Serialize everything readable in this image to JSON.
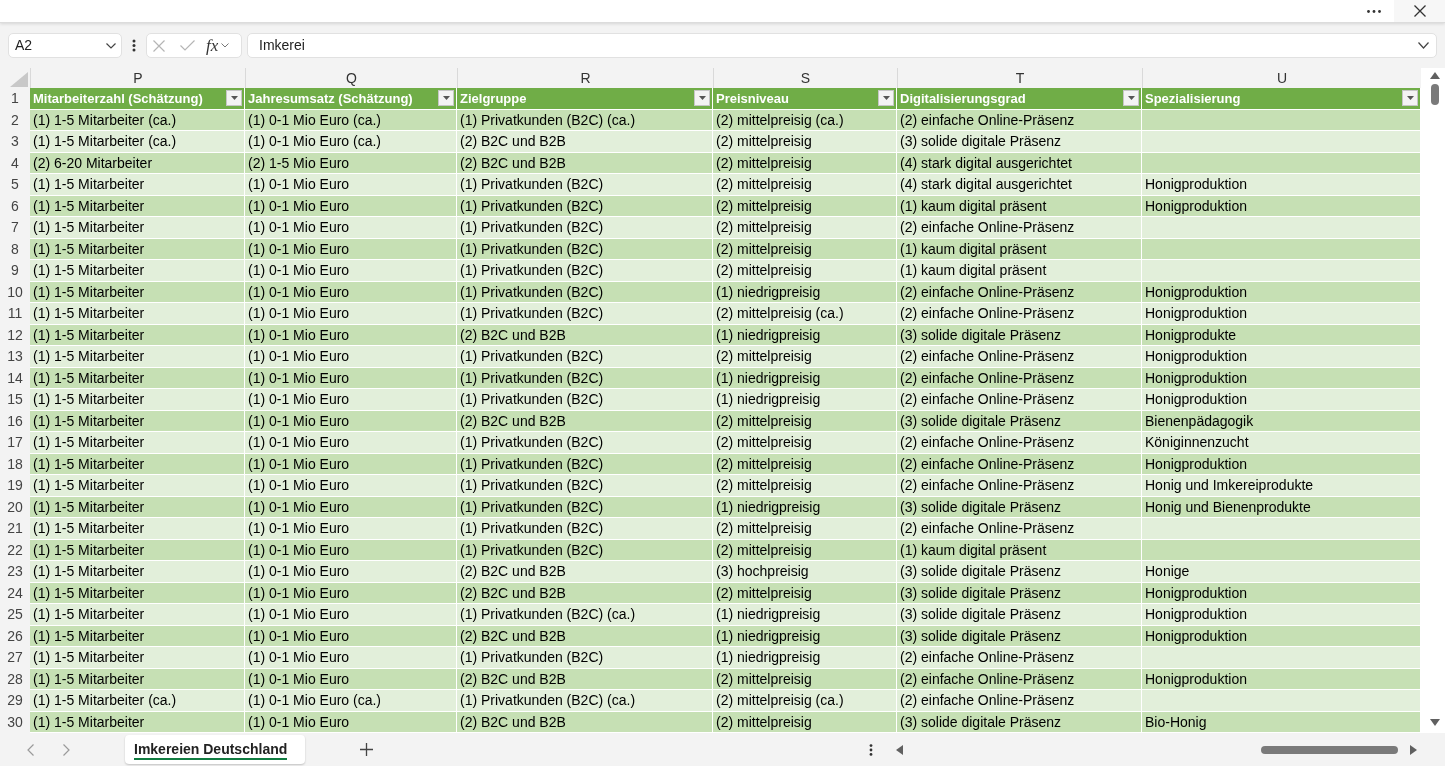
{
  "formula_bar": {
    "name_box": "A2",
    "function_label": "fx",
    "formula": "Imkerei"
  },
  "sheet": {
    "header_row_number": "1",
    "columns": [
      {
        "letter": "P",
        "header": "Mitarbeiterzahl (Schätzung)"
      },
      {
        "letter": "Q",
        "header": "Jahresumsatz (Schätzung)"
      },
      {
        "letter": "R",
        "header": "Zielgruppe"
      },
      {
        "letter": "S",
        "header": "Preisniveau"
      },
      {
        "letter": "T",
        "header": "Digitalisierungsgrad"
      },
      {
        "letter": "U",
        "header": "Spezialisierung"
      }
    ],
    "rows": [
      {
        "number": "2",
        "cells": [
          "(1) 1-5 Mitarbeiter (ca.)",
          "(1) 0-1 Mio Euro (ca.)",
          "(1) Privatkunden (B2C) (ca.)",
          "(2) mittelpreisig (ca.)",
          "(2) einfache Online-Präsenz"
        ]
      },
      {
        "number": "3",
        "cells": [
          "(1) 1-5 Mitarbeiter (ca.)",
          "(1) 0-1 Mio Euro (ca.)",
          "(2) B2C und B2B",
          "(2) mittelpreisig",
          "(3) solide digitale Präsenz"
        ]
      },
      {
        "number": "4",
        "cells": [
          "(2) 6-20 Mitarbeiter",
          "(2) 1-5 Mio Euro",
          "(2) B2C und B2B",
          "(2) mittelpreisig",
          "(4) stark digital ausgerichtet"
        ]
      },
      {
        "number": "5",
        "cells": [
          "(1) 1-5 Mitarbeiter",
          "(1) 0-1 Mio Euro",
          "(1) Privatkunden (B2C)",
          "(2) mittelpreisig",
          "(4) stark digital ausgerichtet",
          "Honigproduktion"
        ]
      },
      {
        "number": "6",
        "cells": [
          "(1) 1-5 Mitarbeiter",
          "(1) 0-1 Mio Euro",
          "(1) Privatkunden (B2C)",
          "(2) mittelpreisig",
          "(1) kaum digital präsent",
          "Honigproduktion"
        ]
      },
      {
        "number": "7",
        "cells": [
          "(1) 1-5 Mitarbeiter",
          "(1) 0-1 Mio Euro",
          "(1) Privatkunden (B2C)",
          "(2) mittelpreisig",
          "(2) einfache Online-Präsenz"
        ]
      },
      {
        "number": "8",
        "cells": [
          "(1) 1-5 Mitarbeiter",
          "(1) 0-1 Mio Euro",
          "(1) Privatkunden (B2C)",
          "(2) mittelpreisig",
          "(1) kaum digital präsent"
        ]
      },
      {
        "number": "9",
        "cells": [
          "(1) 1-5 Mitarbeiter",
          "(1) 0-1 Mio Euro",
          "(1) Privatkunden (B2C)",
          "(2) mittelpreisig",
          "(1) kaum digital präsent"
        ]
      },
      {
        "number": "10",
        "cells": [
          "(1) 1-5 Mitarbeiter",
          "(1) 0-1 Mio Euro",
          "(1) Privatkunden (B2C)",
          "(1) niedrigpreisig",
          "(2) einfache Online-Präsenz",
          "Honigproduktion"
        ]
      },
      {
        "number": "11",
        "cells": [
          "(1) 1-5 Mitarbeiter",
          "(1) 0-1 Mio Euro",
          "(1) Privatkunden (B2C)",
          "(2) mittelpreisig (ca.)",
          "(2) einfache Online-Präsenz",
          "Honigproduktion"
        ]
      },
      {
        "number": "12",
        "cells": [
          "(1) 1-5 Mitarbeiter",
          "(1) 0-1 Mio Euro",
          "(2) B2C und B2B",
          "(1) niedrigpreisig",
          "(3) solide digitale Präsenz",
          "Honigprodukte"
        ]
      },
      {
        "number": "13",
        "cells": [
          "(1) 1-5 Mitarbeiter",
          "(1) 0-1 Mio Euro",
          "(1) Privatkunden (B2C)",
          "(2) mittelpreisig",
          "(2) einfache Online-Präsenz",
          "Honigproduktion"
        ]
      },
      {
        "number": "14",
        "cells": [
          "(1) 1-5 Mitarbeiter",
          "(1) 0-1 Mio Euro",
          "(1) Privatkunden (B2C)",
          "(1) niedrigpreisig",
          "(2) einfache Online-Präsenz",
          "Honigproduktion"
        ]
      },
      {
        "number": "15",
        "cells": [
          "(1) 1-5 Mitarbeiter",
          "(1) 0-1 Mio Euro",
          "(1) Privatkunden (B2C)",
          "(1) niedrigpreisig",
          "(2) einfache Online-Präsenz",
          "Honigproduktion"
        ]
      },
      {
        "number": "16",
        "cells": [
          "(1) 1-5 Mitarbeiter",
          "(1) 0-1 Mio Euro",
          "(2) B2C und B2B",
          "(2) mittelpreisig",
          "(3) solide digitale Präsenz",
          "Bienenpädagogik"
        ]
      },
      {
        "number": "17",
        "cells": [
          "(1) 1-5 Mitarbeiter",
          "(1) 0-1 Mio Euro",
          "(1) Privatkunden (B2C)",
          "(2) mittelpreisig",
          "(2) einfache Online-Präsenz",
          "Königinnenzucht"
        ]
      },
      {
        "number": "18",
        "cells": [
          "(1) 1-5 Mitarbeiter",
          "(1) 0-1 Mio Euro",
          "(1) Privatkunden (B2C)",
          "(2) mittelpreisig",
          "(2) einfache Online-Präsenz",
          "Honigproduktion"
        ]
      },
      {
        "number": "19",
        "cells": [
          "(1) 1-5 Mitarbeiter",
          "(1) 0-1 Mio Euro",
          "(1) Privatkunden (B2C)",
          "(2) mittelpreisig",
          "(2) einfache Online-Präsenz",
          "Honig und Imkereiprodukte"
        ]
      },
      {
        "number": "20",
        "cells": [
          "(1) 1-5 Mitarbeiter",
          "(1) 0-1 Mio Euro",
          "(1) Privatkunden (B2C)",
          "(1) niedrigpreisig",
          "(3) solide digitale Präsenz",
          "Honig und Bienenprodukte"
        ]
      },
      {
        "number": "21",
        "cells": [
          "(1) 1-5 Mitarbeiter",
          "(1) 0-1 Mio Euro",
          "(1) Privatkunden (B2C)",
          "(2) mittelpreisig",
          "(2) einfache Online-Präsenz"
        ]
      },
      {
        "number": "22",
        "cells": [
          "(1) 1-5 Mitarbeiter",
          "(1) 0-1 Mio Euro",
          "(1) Privatkunden (B2C)",
          "(2) mittelpreisig",
          "(1) kaum digital präsent"
        ]
      },
      {
        "number": "23",
        "cells": [
          "(1) 1-5 Mitarbeiter",
          "(1) 0-1 Mio Euro",
          "(2) B2C und B2B",
          "(3) hochpreisig",
          "(3) solide digitale Präsenz",
          "Honige"
        ]
      },
      {
        "number": "24",
        "cells": [
          "(1) 1-5 Mitarbeiter",
          "(1) 0-1 Mio Euro",
          "(2) B2C und B2B",
          "(2) mittelpreisig",
          "(3) solide digitale Präsenz",
          "Honigproduktion"
        ]
      },
      {
        "number": "25",
        "cells": [
          "(1) 1-5 Mitarbeiter",
          "(1) 0-1 Mio Euro",
          "(1) Privatkunden (B2C) (ca.)",
          "(1) niedrigpreisig",
          "(3) solide digitale Präsenz",
          "Honigproduktion"
        ]
      },
      {
        "number": "26",
        "cells": [
          "(1) 1-5 Mitarbeiter",
          "(1) 0-1 Mio Euro",
          "(2) B2C und B2B",
          "(1) niedrigpreisig",
          "(3) solide digitale Präsenz",
          "Honigproduktion"
        ]
      },
      {
        "number": "27",
        "cells": [
          "(1) 1-5 Mitarbeiter",
          "(1) 0-1 Mio Euro",
          "(1) Privatkunden (B2C)",
          "(1) niedrigpreisig",
          "(2) einfache Online-Präsenz"
        ]
      },
      {
        "number": "28",
        "cells": [
          "(1) 1-5 Mitarbeiter",
          "(1) 0-1 Mio Euro",
          "(2) B2C und B2B",
          "(2) mittelpreisig",
          "(2) einfache Online-Präsenz",
          "Honigproduktion"
        ]
      },
      {
        "number": "29",
        "cells": [
          "(1) 1-5 Mitarbeiter (ca.)",
          "(1) 0-1 Mio Euro (ca.)",
          "(1) Privatkunden (B2C) (ca.)",
          "(2) mittelpreisig (ca.)",
          "(2) einfache Online-Präsenz"
        ]
      },
      {
        "number": "30",
        "cells": [
          "(1) 1-5 Mitarbeiter",
          "(1) 0-1 Mio Euro",
          "(2) B2C und B2B",
          "(2) mittelpreisig",
          "(3) solide digitale Präsenz",
          "Bio-Honig"
        ]
      }
    ]
  },
  "sheet_tabs": [
    {
      "label": "Imkereien Deutschland",
      "selected": true
    }
  ]
}
